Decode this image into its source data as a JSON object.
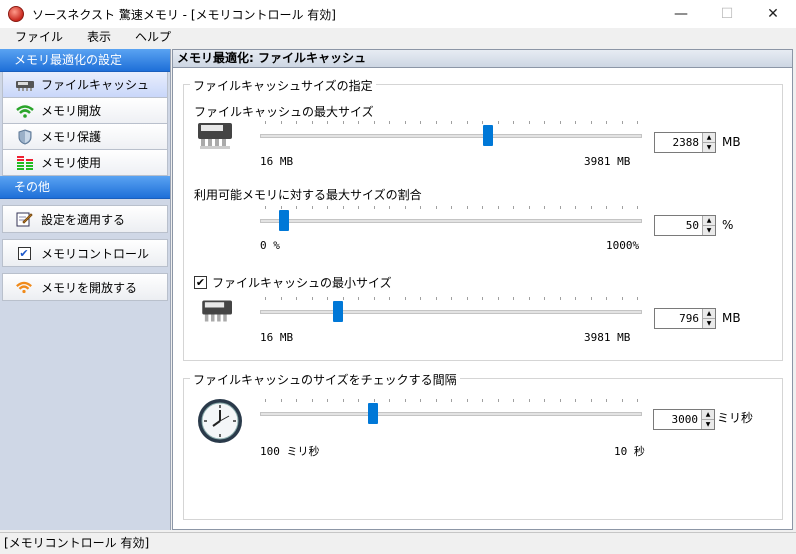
{
  "window": {
    "title": "ソースネクスト 驚速メモリ - [メモリコントロール 有効]",
    "controls": {
      "minimize": "—",
      "maximize": "☐",
      "close": "✕"
    }
  },
  "menu": [
    "ファイル",
    "表示",
    "ヘルプ"
  ],
  "sidebar": {
    "group1_title": "メモリ最適化の設定",
    "items": [
      {
        "label": "ファイルキャッシュ",
        "icon": "ram-chip-icon",
        "active": true
      },
      {
        "label": "メモリ開放",
        "icon": "wifi-release-icon",
        "active": false
      },
      {
        "label": "メモリ保護",
        "icon": "shield-icon",
        "active": false
      },
      {
        "label": "メモリ使用",
        "icon": "bar-graph-icon",
        "active": false
      }
    ],
    "group2_title": "その他",
    "actions": [
      {
        "label": "設定を適用する",
        "icon": "edit-apply-icon"
      },
      {
        "label": "メモリコントロール",
        "icon": "checkbox-icon",
        "checked": true
      },
      {
        "label": "メモリを開放する",
        "icon": "release-icon"
      }
    ]
  },
  "main": {
    "header": "メモリ最適化: ファイルキャッシュ",
    "cache_group": {
      "legend": "ファイルキャッシュサイズの指定",
      "max_size": {
        "label": "ファイルキャッシュの最大サイズ",
        "min_label": "16 MB",
        "max_label": "3981 MB",
        "value": "2388",
        "unit": "MB",
        "position": 0.599
      },
      "ratio": {
        "label": "利用可能メモリに対する最大サイズの割合",
        "min_label": "0 %",
        "max_label": "1000%",
        "value": "50",
        "unit": "%",
        "position": 0.05
      },
      "min_size": {
        "label": "ファイルキャッシュの最小サイズ",
        "checked": true,
        "min_label": "16 MB",
        "max_label": "3981 MB",
        "value": "796",
        "unit": "MB",
        "position": 0.197
      }
    },
    "interval_group": {
      "legend": "ファイルキャッシュのサイズをチェックする間隔",
      "min_label": "100 ミリ秒",
      "max_label": "10 秒",
      "value": "3000",
      "unit": "ミリ秒",
      "position": 0.29
    }
  },
  "status": "[メモリコントロール 有効]"
}
